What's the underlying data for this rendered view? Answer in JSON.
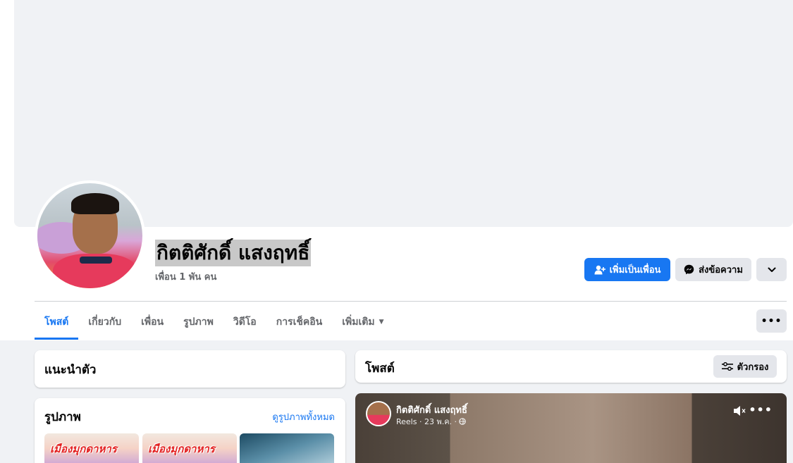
{
  "profile": {
    "name": "กิตติศักดิ์ แสงฤทธิ์",
    "friends": "เพื่อน 1 พัน คน"
  },
  "actions": {
    "add_friend": "เพิ่มเป็นเพื่อน",
    "message": "ส่งข้อความ"
  },
  "tabs": [
    {
      "label": "โพสต์",
      "active": true
    },
    {
      "label": "เกี่ยวกับ",
      "active": false
    },
    {
      "label": "เพื่อน",
      "active": false
    },
    {
      "label": "รูปภาพ",
      "active": false
    },
    {
      "label": "วิดีโอ",
      "active": false
    },
    {
      "label": "การเช็คอิน",
      "active": false
    },
    {
      "label": "เพิ่มเติม",
      "active": false
    }
  ],
  "intro": {
    "title": "แนะนำตัว"
  },
  "photos": {
    "title": "รูปภาพ",
    "see_all": "ดูรูปภาพทั้งหมด",
    "thumb_banner": "เมืองมุกดาหาร"
  },
  "posts": {
    "title": "โพสต์",
    "filter": "ตัวกรอง"
  },
  "reel": {
    "author": "กิตติศักดิ์ แสงฤทธิ์",
    "meta": "Reels · 23 พ.ค. ·"
  },
  "colors": {
    "accent": "#1877f2",
    "page_bg": "#f0f2f5",
    "button_bg": "#e4e6eb",
    "muted_text": "#65676b"
  }
}
